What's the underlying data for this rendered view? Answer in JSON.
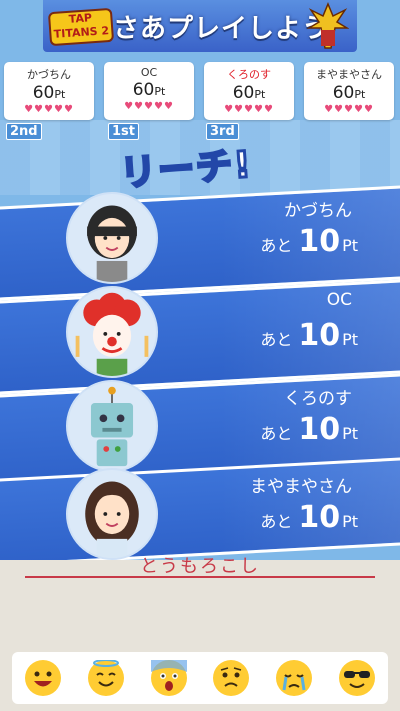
{
  "ad": {
    "logo_text": "TAP TITANS 2",
    "headline": "さあプレイしよう"
  },
  "scoreboard": [
    {
      "name": "かづちん",
      "points": "60",
      "unit": "Pt",
      "hearts": "♥♥♥♥♥",
      "highlight": false
    },
    {
      "name": "OC",
      "points": "60",
      "unit": "Pt",
      "hearts": "♥♥♥♥♥",
      "highlight": false
    },
    {
      "name": "くろのす",
      "points": "60",
      "unit": "Pt",
      "hearts": "♥♥♥♥♥",
      "highlight": true
    },
    {
      "name": "まやまやさん",
      "points": "60",
      "unit": "Pt",
      "hearts": "♥♥♥♥♥",
      "highlight": false
    }
  ],
  "ranks": [
    "2nd",
    "1st",
    "3rd"
  ],
  "reach_title": "リーチ!",
  "players": [
    {
      "name": "かづちん",
      "prefix": "あと",
      "value": "10",
      "unit": "Pt",
      "avatar": "woman-bob-avatar"
    },
    {
      "name": "OC",
      "prefix": "あと",
      "value": "10",
      "unit": "Pt",
      "avatar": "clown-avatar"
    },
    {
      "name": "くろのす",
      "prefix": "あと",
      "value": "10",
      "unit": "Pt",
      "avatar": "robot-avatar"
    },
    {
      "name": "まやまやさん",
      "prefix": "あと",
      "value": "10",
      "unit": "Pt",
      "avatar": "woman-long-hair-avatar"
    }
  ],
  "answer_text": "とうもろこし",
  "emojis": [
    "grinning-face",
    "smiling-halo-face",
    "anxious-sweat-face",
    "worried-face",
    "crying-face",
    "sunglasses-face"
  ],
  "colors": {
    "accent_blue": "#3d74d9",
    "heart_pink": "#e84b7a",
    "answer_red": "#c83a48",
    "emoji_yellow": "#ffcc33"
  }
}
